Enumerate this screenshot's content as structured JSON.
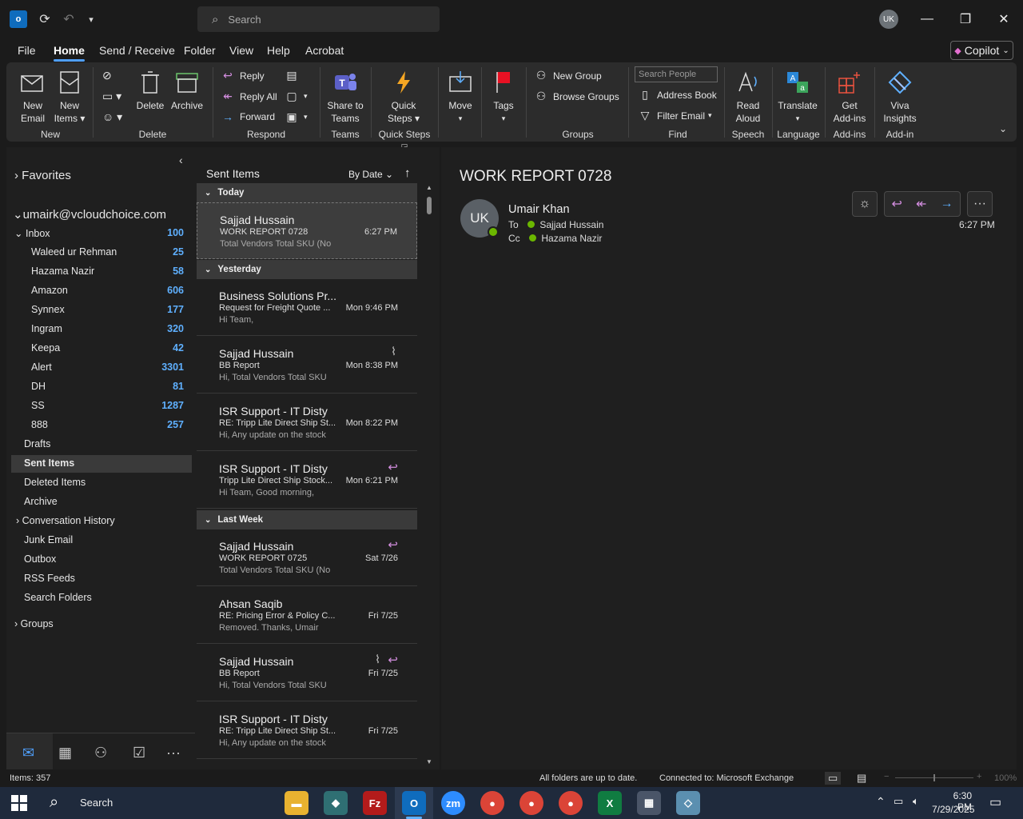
{
  "titlebar": {
    "search_placeholder": "Search",
    "avatar_initials": "UK"
  },
  "menu": [
    "File",
    "Home",
    "Send / Receive",
    "Folder",
    "View",
    "Help",
    "Acrobat"
  ],
  "copilot_label": "Copilot",
  "ribbon": {
    "new_email": [
      "New",
      "Email"
    ],
    "new_items": [
      "New",
      "Items"
    ],
    "group_new": "New",
    "delete": "Delete",
    "archive": "Archive",
    "group_delete": "Delete",
    "reply": "Reply",
    "reply_all": "Reply All",
    "forward": "Forward",
    "group_respond": "Respond",
    "share_teams": [
      "Share to",
      "Teams"
    ],
    "group_teams": "Teams",
    "quick_steps": [
      "Quick",
      "Steps"
    ],
    "group_quick_steps": "Quick Steps",
    "move": "Move",
    "tags": "Tags",
    "new_group": "New Group",
    "browse_groups": "Browse Groups",
    "group_groups": "Groups",
    "search_people_placeholder": "Search People",
    "address_book": "Address Book",
    "filter_email": "Filter Email",
    "group_find": "Find",
    "read_aloud": [
      "Read",
      "Aloud"
    ],
    "group_speech": "Speech",
    "translate": "Translate",
    "group_language": "Language",
    "get_addins": [
      "Get",
      "Add-ins"
    ],
    "group_addins": "Add-ins",
    "viva": [
      "Viva",
      "Insights"
    ],
    "group_addin": "Add-in"
  },
  "folders": {
    "favorites": "Favorites",
    "account": "umairk@vcloudchoice.com",
    "inbox": {
      "label": "Inbox",
      "count": "100"
    },
    "subfolders": [
      {
        "label": "Waleed ur Rehman",
        "count": "25"
      },
      {
        "label": "Hazama Nazir",
        "count": "58"
      },
      {
        "label": "Amazon",
        "count": "606"
      },
      {
        "label": "Synnex",
        "count": "177"
      },
      {
        "label": "Ingram",
        "count": "320"
      },
      {
        "label": "Keepa",
        "count": "42"
      },
      {
        "label": "Alert",
        "count": "3301"
      },
      {
        "label": "DH",
        "count": "81"
      },
      {
        "label": "SS",
        "count": "1287"
      },
      {
        "label": "888",
        "count": "257"
      }
    ],
    "others": [
      "Drafts",
      "Sent Items",
      "Deleted Items",
      "Archive",
      "Conversation History",
      "Junk Email",
      "Outbox",
      "RSS Feeds",
      "Search Folders"
    ],
    "groups": "Groups"
  },
  "list": {
    "title": "Sent Items",
    "sort": "By Date",
    "groups": {
      "today": "Today",
      "yesterday": "Yesterday",
      "last_week": "Last Week"
    },
    "messages": [
      {
        "from": "Sajjad Hussain",
        "subject": "WORK REPORT 0728",
        "preview": "Total Vendors  Total SKU (No",
        "time": "6:27 PM"
      },
      {
        "from": "Business Solutions Pr...",
        "subject": "Request for Freight Quote ...",
        "preview": "Hi Team,",
        "time": "Mon 9:46 PM"
      },
      {
        "from": "Sajjad Hussain",
        "subject": "BB Report",
        "preview": "Hi,  Total Vendors  Total SKU",
        "time": "Mon 8:38 PM"
      },
      {
        "from": "ISR Support - IT Disty",
        "subject": "RE: Tripp Lite Direct Ship St...",
        "preview": "Hi,  Any update on the stock",
        "time": "Mon 8:22 PM"
      },
      {
        "from": "ISR Support - IT Disty",
        "subject": "Tripp Lite Direct Ship Stock...",
        "preview": "Hi Team,  Good morning,",
        "time": "Mon 6:21 PM"
      },
      {
        "from": "Sajjad Hussain",
        "subject": "WORK REPORT 0725",
        "preview": "Total Vendors  Total SKU (No",
        "time": "Sat 7/26"
      },
      {
        "from": "Ahsan Saqib",
        "subject": "RE: Pricing Error & Policy C...",
        "preview": "Removed.  Thanks,  Umair",
        "time": "Fri 7/25"
      },
      {
        "from": "Sajjad Hussain",
        "subject": "BB Report",
        "preview": "Hi,  Total Vendors  Total SKU",
        "time": "Fri 7/25"
      },
      {
        "from": "ISR Support - IT Disty",
        "subject": "RE: Tripp Lite Direct Ship St...",
        "preview": "Hi,  Any update on the stock",
        "time": "Fri 7/25"
      }
    ]
  },
  "reading": {
    "subject": "WORK REPORT 0728",
    "sender_initials": "UK",
    "sender": "Umair Khan",
    "to_label": "To",
    "to": "Sajjad Hussain",
    "cc_label": "Cc",
    "cc": "Hazama Nazir",
    "time": "6:27 PM"
  },
  "status": {
    "items": "Items: 357",
    "sync": "All folders are up to date.",
    "connection": "Connected to: Microsoft Exchange",
    "zoom": "100%"
  },
  "taskbar": {
    "search": "Search",
    "time": "6:30 PM",
    "date": "7/29/2025"
  },
  "colors": {
    "accent": "#4f9ef8",
    "count": "#5fb0ff",
    "reply_icon": "#d48ee0",
    "online": "#6bb700"
  }
}
